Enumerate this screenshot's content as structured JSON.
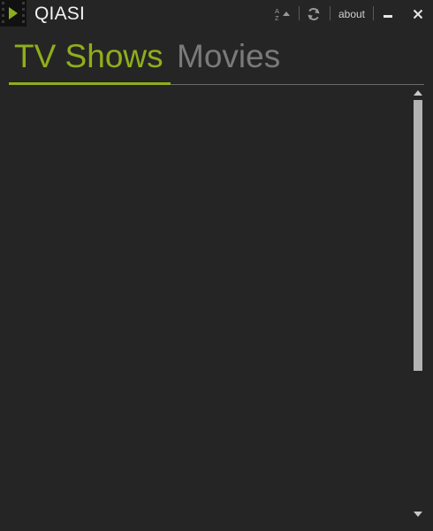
{
  "app": {
    "title": "QIASI",
    "logo_icon": "film-play-icon"
  },
  "titlebar": {
    "sort_icon": "sort-az-icon",
    "refresh_icon": "refresh-icon",
    "about_label": "about",
    "minimize_icon": "minimize-icon",
    "close_icon": "close-icon"
  },
  "tabs": [
    {
      "label": "TV Shows",
      "active": true
    },
    {
      "label": "Movies",
      "active": false
    }
  ],
  "list": {
    "items": []
  },
  "colors": {
    "accent": "#8fae1b",
    "background": "#252525",
    "inactive_tab": "#7a7a7a",
    "title_text": "#f2f2f2"
  }
}
